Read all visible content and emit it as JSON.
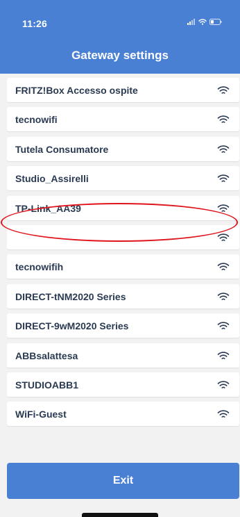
{
  "status_bar": {
    "time": "11:26"
  },
  "header": {
    "title": "Gateway settings"
  },
  "networks": [
    {
      "ssid": "FRITZ!Box Accesso ospite"
    },
    {
      "ssid": "tecnowifi"
    },
    {
      "ssid": "Tutela Consumatore"
    },
    {
      "ssid": "Studio_Assirelli"
    },
    {
      "ssid": "TP-Link_AA39"
    },
    {
      "ssid": ""
    },
    {
      "ssid": "tecnowifih"
    },
    {
      "ssid": "DIRECT-tNM2020 Series"
    },
    {
      "ssid": "DIRECT-9wM2020 Series"
    },
    {
      "ssid": "ABBsalattesa"
    },
    {
      "ssid": "STUDIOABB1"
    },
    {
      "ssid": "WiFi-Guest"
    }
  ],
  "highlighted_network_index": 4,
  "footer": {
    "exit_label": "Exit"
  },
  "colors": {
    "accent": "#4a80d4",
    "highlight": "#e0141c",
    "row_text": "#2a3a52",
    "background": "#f2f2f2"
  },
  "icons": {
    "row_icon": "wifi-icon",
    "status_icons": [
      "cellular-signal-icon",
      "wifi-icon",
      "battery-icon"
    ]
  }
}
